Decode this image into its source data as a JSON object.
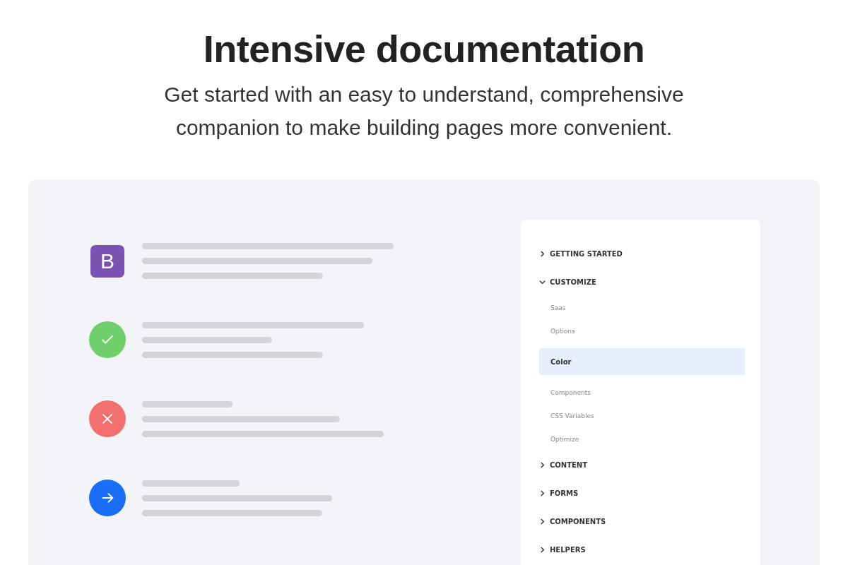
{
  "heading": "Intensive documentation",
  "subtitle": "Get started with an easy to understand, comprehensive companion to make building pages more convenient.",
  "features": [
    {
      "kind": "logo",
      "letter": "B",
      "color": "#7952b3"
    },
    {
      "kind": "check",
      "color": "#6fcf6a"
    },
    {
      "kind": "cross",
      "color": "#f2706d"
    },
    {
      "kind": "arrow",
      "color": "#1a6ef5"
    }
  ],
  "nav": {
    "sections": [
      {
        "label": "GETTING STARTED",
        "expanded": false
      },
      {
        "label": "CUSTOMIZE",
        "expanded": true,
        "children": [
          {
            "label": "Saas",
            "selected": false
          },
          {
            "label": "Options",
            "selected": false
          },
          {
            "label": "Color",
            "selected": true
          },
          {
            "label": "Components",
            "selected": false
          },
          {
            "label": "CSS Variables",
            "selected": false
          },
          {
            "label": "Optimize",
            "selected": false
          }
        ]
      },
      {
        "label": "CONTENT",
        "expanded": false
      },
      {
        "label": "FORMS",
        "expanded": false
      },
      {
        "label": "COMPONENTS",
        "expanded": false
      },
      {
        "label": "HELPERS",
        "expanded": false
      }
    ]
  }
}
